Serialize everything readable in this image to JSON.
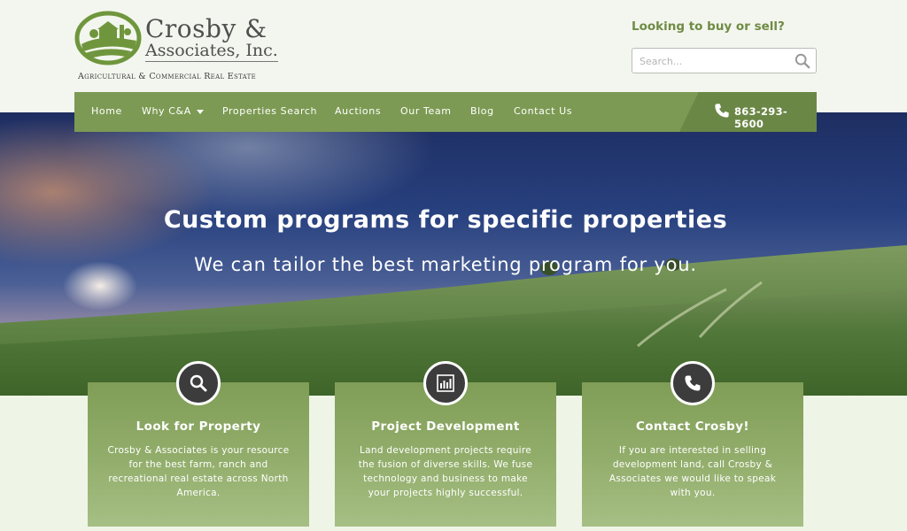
{
  "brand": {
    "name_line1": "Crosby &",
    "name_line2": "Associates, Inc.",
    "tagline": "Agricultural & Commercial Real Estate"
  },
  "header": {
    "buy_sell": "Looking to buy or sell?",
    "search_placeholder": "Search..."
  },
  "nav": {
    "items": [
      "Home",
      "Why C&A",
      "Properties Search",
      "Auctions",
      "Our Team",
      "Blog",
      "Contact Us"
    ],
    "phone": "863-293-5600"
  },
  "hero": {
    "title": "Custom programs for specific properties",
    "subtitle": "We can tailor the best marketing program for you."
  },
  "cards": [
    {
      "icon": "search-icon",
      "title": "Look for Property",
      "text": "Crosby & Associates is your resource for the best farm, ranch and recreational real estate across North America."
    },
    {
      "icon": "chart-icon",
      "title": "Project Development",
      "text": "Land development projects require the fusion of diverse skills. We fuse technology and business to make your projects highly successful."
    },
    {
      "icon": "phone-icon",
      "title": "Contact Crosby!",
      "text": "If you are interested in selling development land, call Crosby & Associates we would like to speak with you."
    }
  ],
  "colors": {
    "brand_green": "#7c9a53",
    "dark_green": "#6b8746",
    "badge": "#3c3c3c"
  }
}
